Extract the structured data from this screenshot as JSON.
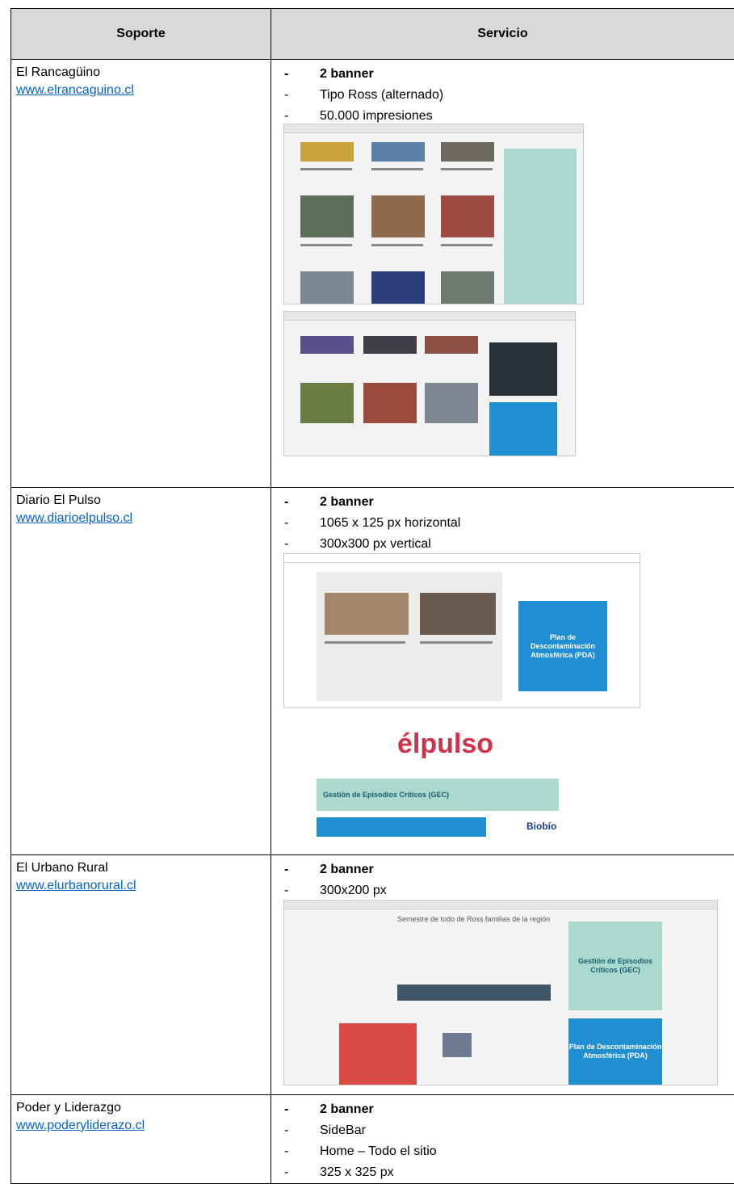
{
  "headers": {
    "soporte": "Soporte",
    "servicio": "Servicio"
  },
  "rows": [
    {
      "name": "El Rancagüino",
      "url": "www.elrancaguino.cl",
      "services": [
        {
          "text": "2 banner",
          "bold": true
        },
        {
          "text": "Tipo Ross (alternado)",
          "bold": false
        },
        {
          "text": "50.000 impresiones",
          "bold": false
        }
      ]
    },
    {
      "name": "Diario El Pulso",
      "url": "www.diarioelpulso.cl",
      "services": [
        {
          "text": "2 banner",
          "bold": true
        },
        {
          "text": "1065 x 125 px horizontal",
          "bold": false
        },
        {
          "text": "300x300 px vertical",
          "bold": false
        }
      ],
      "logo": "élpulso",
      "ad_gec": "Gestión de Episodios Críticos (GEC)",
      "ad_pda": "Plan de Descontaminación Atmosférica (PDA)",
      "ad_biobio": "Biobío"
    },
    {
      "name": "El Urbano Rural",
      "url": "www.elurbanorural.cl",
      "services": [
        {
          "text": "2 banner",
          "bold": true
        },
        {
          "text": "300x200 px",
          "bold": false
        }
      ],
      "headline": "Semestre de todo de Ross familias de la región",
      "ad_gec": "Gestión de Episodios Críticos (GEC)",
      "ad_pda": "Plan de Descontaminación Atmosférica (PDA)"
    },
    {
      "name": "Poder y Liderazgo",
      "url": "www.poderyliderazo.cl",
      "services": [
        {
          "text": "2 banner",
          "bold": true
        },
        {
          "text": "SideBar",
          "bold": false
        },
        {
          "text": "Home – Todo el sitio",
          "bold": false
        },
        {
          "text": "325 x 325 px",
          "bold": false
        }
      ]
    }
  ],
  "colors": {
    "header_bg": "#d9d9d9",
    "link": "#0563c1",
    "ad_blue": "#1f8fd1",
    "ad_teal": "#a9d9cf"
  }
}
